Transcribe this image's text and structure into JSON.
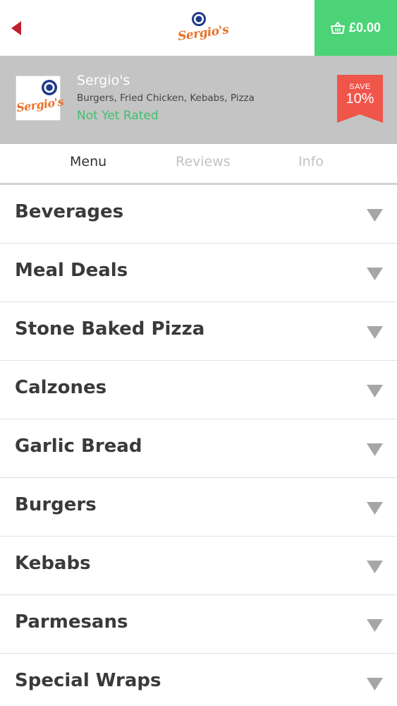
{
  "topbar": {
    "back_icon": "back-arrow-icon",
    "logo_text": "Sergio's",
    "basket_icon": "basket-icon",
    "basket_total": "£0.00",
    "accent_color": "#4cd377",
    "back_color": "#c0202f"
  },
  "restaurant": {
    "logo_text": "Sergio's",
    "name": "Sergio's",
    "cuisines": "Burgers, Fried Chicken, Kebabs, Pizza",
    "rating_text": "Not Yet Rated",
    "rating_color": "#3fbf6a",
    "header_bg": "#c4c4c4",
    "save_badge": {
      "label": "SAVE",
      "value": "10%",
      "color": "#f0554a"
    }
  },
  "tabs": [
    {
      "label": "Menu",
      "active": true
    },
    {
      "label": "Reviews",
      "active": false
    },
    {
      "label": "Info",
      "active": false
    }
  ],
  "categories": [
    {
      "label": "Beverages",
      "icon": "chevron-down-icon"
    },
    {
      "label": "Meal Deals",
      "icon": "chevron-down-icon"
    },
    {
      "label": "Stone Baked Pizza",
      "icon": "chevron-down-icon"
    },
    {
      "label": "Calzones",
      "icon": "chevron-down-icon"
    },
    {
      "label": "Garlic Bread",
      "icon": "chevron-down-icon"
    },
    {
      "label": "Burgers",
      "icon": "chevron-down-icon"
    },
    {
      "label": "Kebabs",
      "icon": "chevron-down-icon"
    },
    {
      "label": "Parmesans",
      "icon": "chevron-down-icon"
    },
    {
      "label": "Special Wraps",
      "icon": "chevron-down-icon"
    }
  ]
}
